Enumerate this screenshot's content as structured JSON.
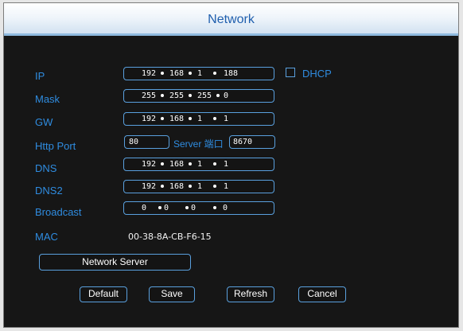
{
  "window": {
    "title": "Network"
  },
  "fields": {
    "ip": {
      "label": "IP",
      "segments": [
        "192",
        "168",
        "1",
        "188"
      ]
    },
    "mask": {
      "label": "Mask",
      "segments": [
        "255",
        "255",
        "255",
        "0"
      ]
    },
    "gw": {
      "label": "GW",
      "segments": [
        "192",
        "168",
        "1",
        "1"
      ]
    },
    "http_port": {
      "label": "Http Port",
      "value": "80"
    },
    "server_port": {
      "label": "Server 端口",
      "value": "8670"
    },
    "dns": {
      "label": "DNS",
      "segments": [
        "192",
        "168",
        "1",
        "1"
      ]
    },
    "dns2": {
      "label": "DNS2",
      "segments": [
        "192",
        "168",
        "1",
        "1"
      ]
    },
    "broadcast": {
      "label": "Broadcast",
      "segments": [
        "0",
        "0",
        "0",
        "0"
      ]
    },
    "mac": {
      "label": "MAC",
      "value": "00-38-8A-CB-F6-15"
    }
  },
  "dhcp": {
    "label": "DHCP",
    "checked": false
  },
  "buttons": {
    "network_server": "Network Server",
    "default": "Default",
    "save": "Save",
    "refresh": "Refresh",
    "cancel": "Cancel"
  }
}
